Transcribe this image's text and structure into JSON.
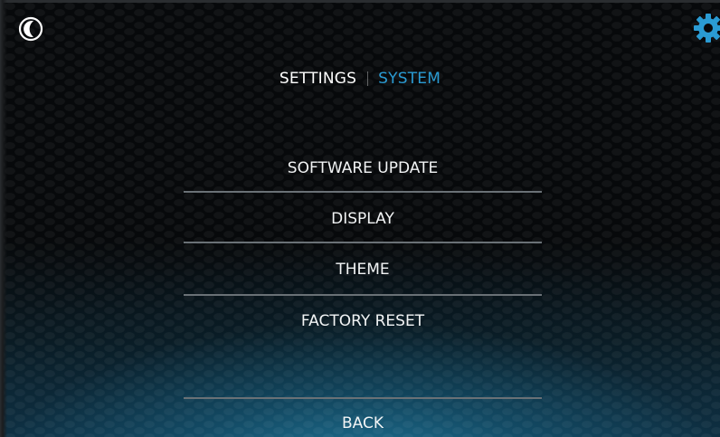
{
  "header": {
    "theme_icon": "moon-icon",
    "settings_icon": "gear-icon",
    "accent_color": "#2a9bd3"
  },
  "tabs": [
    {
      "label": "SETTINGS",
      "active": false
    },
    {
      "label": "SYSTEM",
      "active": true
    }
  ],
  "menu": {
    "items": [
      {
        "label": "SOFTWARE UPDATE"
      },
      {
        "label": "DISPLAY"
      },
      {
        "label": "THEME"
      },
      {
        "label": "FACTORY RESET"
      }
    ],
    "back_label": "BACK"
  }
}
